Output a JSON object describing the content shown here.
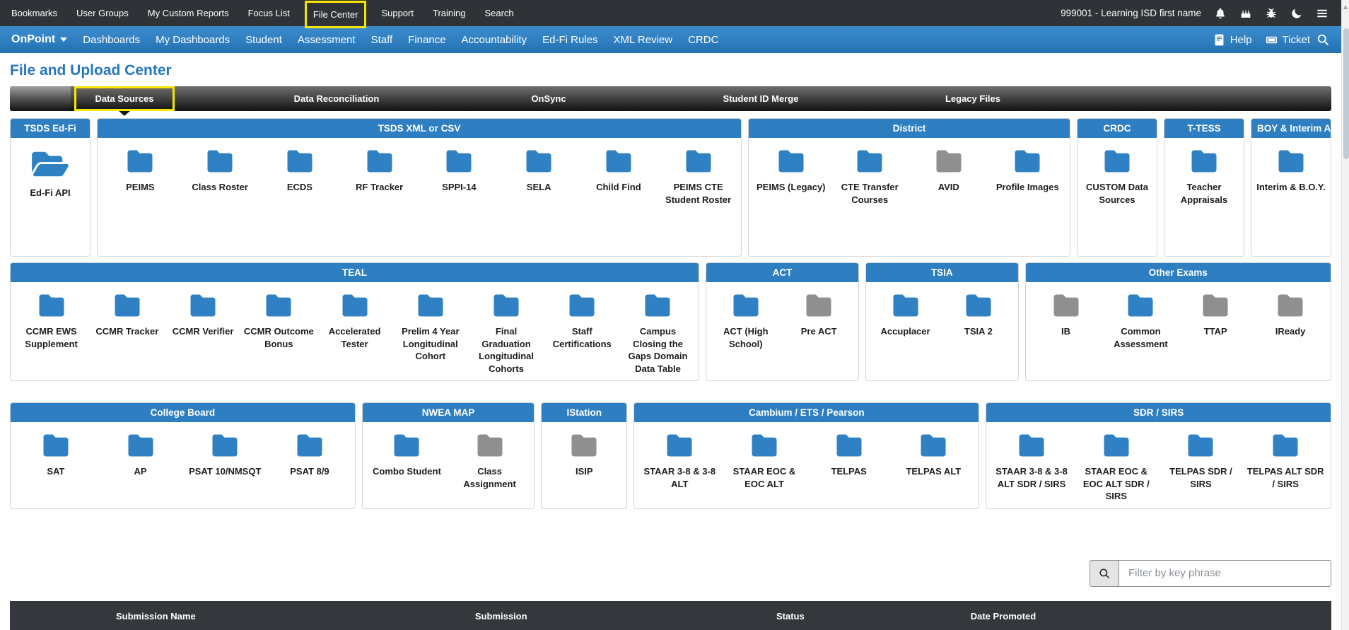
{
  "colors": {
    "topbar_bg": "#2f3237",
    "accent_blue": "#2e7fc1",
    "title_blue": "#2677bd",
    "folder_blue": "#3081c3",
    "folder_gray": "#8f8f8f",
    "highlight_yellow": "#f7e600",
    "table_header_bg": "#34383d"
  },
  "topbar": {
    "items": [
      "Bookmarks",
      "User Groups",
      "My Custom Reports",
      "Focus List",
      "File Center",
      "Support",
      "Training",
      "Search"
    ],
    "highlighted_item": "File Center",
    "user": "999001 - Learning ISD first name",
    "icons": [
      "bell-icon",
      "cake-icon",
      "bug-icon",
      "moon-icon",
      "menu-icon"
    ]
  },
  "navbar": {
    "brand": "OnPoint",
    "items": [
      "Dashboards",
      "My Dashboards",
      "Student",
      "Assessment",
      "Staff",
      "Finance",
      "Accountability",
      "Ed-Fi Rules",
      "XML Review",
      "CRDC"
    ],
    "help_label": "Help",
    "ticket_label": "Ticket"
  },
  "page": {
    "title": "File and Upload Center"
  },
  "tabs": {
    "items": [
      "Data Sources",
      "Data Reconciliation",
      "OnSync",
      "Student ID Merge",
      "Legacy Files"
    ],
    "active": "Data Sources"
  },
  "rows": [
    {
      "cards": [
        {
          "title": "TSDS Ed-Fi",
          "items": [
            {
              "label": "Ed-Fi API",
              "icon": "folder-open"
            }
          ]
        },
        {
          "title": "TSDS XML or CSV",
          "items": [
            {
              "label": "PEIMS"
            },
            {
              "label": "Class Roster"
            },
            {
              "label": "ECDS"
            },
            {
              "label": "RF Tracker"
            },
            {
              "label": "SPPI-14"
            },
            {
              "label": "SELA"
            },
            {
              "label": "Child Find"
            },
            {
              "label": "PEIMS CTE Student Roster"
            }
          ]
        },
        {
          "title": "District",
          "items": [
            {
              "label": "PEIMS (Legacy)"
            },
            {
              "label": "CTE Transfer Courses"
            },
            {
              "label": "AVID",
              "color": "gray"
            },
            {
              "label": "Profile Images"
            }
          ]
        },
        {
          "title": "CRDC",
          "items": [
            {
              "label": "CUSTOM Data Sources"
            }
          ]
        },
        {
          "title": "T-TESS",
          "items": [
            {
              "label": "Teacher Appraisals"
            }
          ]
        },
        {
          "title": "BOY & Interim Assessment",
          "items": [
            {
              "label": "Interim & B.O.Y."
            }
          ]
        }
      ]
    },
    {
      "cards": [
        {
          "title": "TEAL",
          "items": [
            {
              "label": "CCMR EWS Supplement"
            },
            {
              "label": "CCMR Tracker"
            },
            {
              "label": "CCMR Verifier"
            },
            {
              "label": "CCMR Outcome Bonus"
            },
            {
              "label": "Accelerated Tester"
            },
            {
              "label": "Prelim 4 Year Longitudinal Cohort"
            },
            {
              "label": "Final Graduation Longitudinal Cohorts"
            },
            {
              "label": "Staff Certifications"
            },
            {
              "label": "Campus Closing the Gaps Domain Data Table"
            }
          ]
        },
        {
          "title": "ACT",
          "items": [
            {
              "label": "ACT (High School)"
            },
            {
              "label": "Pre ACT",
              "color": "gray"
            }
          ]
        },
        {
          "title": "TSIA",
          "items": [
            {
              "label": "Accuplacer"
            },
            {
              "label": "TSIA 2"
            }
          ]
        },
        {
          "title": "Other Exams",
          "items": [
            {
              "label": "IB",
              "color": "gray"
            },
            {
              "label": "Common Assessment"
            },
            {
              "label": "TTAP",
              "color": "gray"
            },
            {
              "label": "IReady",
              "color": "gray"
            }
          ]
        }
      ]
    },
    {
      "cards": [
        {
          "title": "College Board",
          "items": [
            {
              "label": "SAT"
            },
            {
              "label": "AP"
            },
            {
              "label": "PSAT 10/NMSQT"
            },
            {
              "label": "PSAT 8/9"
            }
          ]
        },
        {
          "title": "NWEA MAP",
          "items": [
            {
              "label": "Combo Student"
            },
            {
              "label": "Class Assignment",
              "color": "gray"
            }
          ]
        },
        {
          "title": "IStation",
          "items": [
            {
              "label": "ISIP",
              "color": "gray"
            }
          ]
        },
        {
          "title": "Cambium / ETS / Pearson",
          "items": [
            {
              "label": "STAAR 3-8 & 3-8 ALT"
            },
            {
              "label": "STAAR EOC & EOC ALT"
            },
            {
              "label": "TELPAS"
            },
            {
              "label": "TELPAS ALT"
            }
          ]
        },
        {
          "title": "SDR / SIRS",
          "items": [
            {
              "label": "STAAR 3-8 & 3-8 ALT SDR / SIRS"
            },
            {
              "label": "STAAR EOC & EOC ALT SDR / SIRS"
            },
            {
              "label": "TELPAS SDR / SIRS"
            },
            {
              "label": "TELPAS ALT SDR / SIRS"
            }
          ]
        }
      ]
    }
  ],
  "filter": {
    "placeholder": "Filter by key phrase"
  },
  "table": {
    "columns": [
      "Submission Name",
      "Submission",
      "Status",
      "Date Promoted"
    ]
  }
}
